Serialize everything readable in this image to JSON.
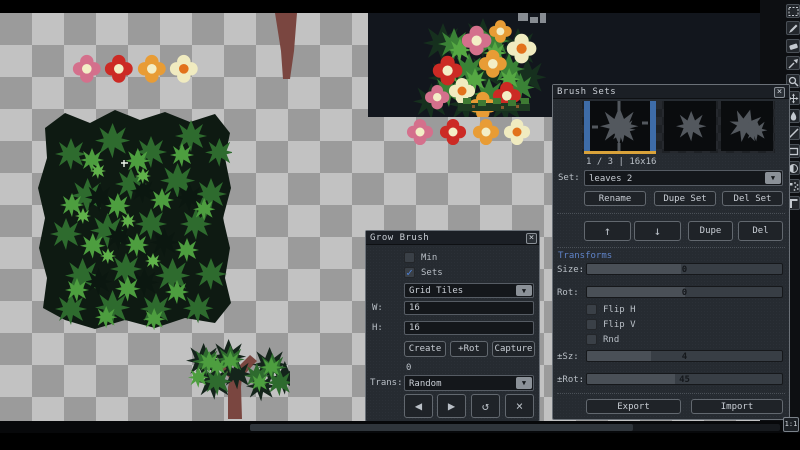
{
  "toolbar": {
    "tools": [
      "rect-select",
      "pencil",
      "eraser",
      "eyedropper",
      "zoom",
      "move",
      "paint",
      "line",
      "rectangle",
      "ellipse",
      "spray",
      "slice"
    ]
  },
  "grow_brush": {
    "title": "Grow Brush",
    "close": "×",
    "min_label": "Min",
    "sets_label": "Sets",
    "check": "✓",
    "mode_value": "Grid Tiles",
    "w_label": "W:",
    "w_value": "16",
    "h_label": "H:",
    "h_value": "16",
    "create": "Create",
    "plus_rot": "+Rot",
    "capture": "Capture",
    "count": "0",
    "trans_label": "Trans:",
    "trans_value": "Random",
    "dd_arrow": "▼",
    "nav_prev": "◀",
    "nav_next": "▶",
    "nav_reset": "↺",
    "nav_close": "×"
  },
  "brush_sets": {
    "title": "Brush Sets",
    "close": "×",
    "counter": "1 / 3  |  16x16",
    "set_label": "Set:",
    "set_value": "leaves 2",
    "dd_arrow": "▼",
    "rename": "Rename",
    "dupe_set": "Dupe Set",
    "del_set": "Del Set",
    "up": "↑",
    "down": "↓",
    "dupe": "Dupe",
    "del": "Del",
    "transforms_title": "Transforms",
    "size_label": "Size:",
    "size_value": "0",
    "rot_label": "Rot:",
    "rot_value": "0",
    "flip_h_label": "Flip H",
    "flip_v_label": "Flip V",
    "rnd_label": "Rnd",
    "dsz_label": "±Sz:",
    "dsz_value": "4",
    "drot_label": "±Rot:",
    "drot_value": "45",
    "export": "Export",
    "import": "Import",
    "fills": {
      "size": 48,
      "rot": 50,
      "dsz": 33,
      "drot": 45
    }
  },
  "statusbar": {
    "zoom_button": "1:1"
  },
  "colors": {
    "selection_blue": "#3e6ca8",
    "selection_yellow": "#d9a23a",
    "section_blue": "#5f83c8",
    "canvas_light": "#c2c2c2",
    "canvas_dark": "#9b9b9b"
  }
}
